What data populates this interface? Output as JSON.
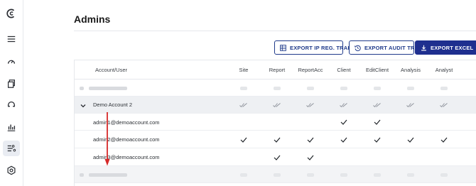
{
  "page": {
    "title": "Admins"
  },
  "sidebar": {
    "items": [
      {
        "name": "logo-icon",
        "active": false
      },
      {
        "name": "menu-icon",
        "active": false
      },
      {
        "name": "gauge-icon",
        "active": false
      },
      {
        "name": "copy-icon",
        "active": false
      },
      {
        "name": "headset-icon",
        "active": false
      },
      {
        "name": "bar-chart-icon",
        "active": false
      },
      {
        "name": "list-settings-icon",
        "active": true
      },
      {
        "name": "settings-icon",
        "active": false
      }
    ]
  },
  "toolbar": {
    "export_ip_label": "EXPORT IP REG. TRAIL",
    "export_audit_label": "EXPORT AUDIT TRAIL",
    "export_excel_label": "EXPORT EXCEL"
  },
  "table": {
    "columns": [
      "Account/User",
      "Site",
      "Report",
      "ReportAcc",
      "Client",
      "EditClient",
      "Analysis",
      "Analyst"
    ],
    "group": {
      "label": "Demo Account 2",
      "expanded": true
    },
    "users": [
      {
        "email": "admin1@demoaccount.com",
        "perms": [
          false,
          false,
          false,
          true,
          true,
          false,
          false
        ]
      },
      {
        "email": "admin2@demoaccount.com",
        "perms": [
          true,
          true,
          true,
          true,
          true,
          true,
          true
        ]
      },
      {
        "email": "admin3@demoaccount.com",
        "perms": [
          false,
          true,
          true,
          false,
          false,
          false,
          false
        ]
      }
    ]
  },
  "colors": {
    "accent": "#1f2f8f",
    "annotation_arrow": "#d62828"
  }
}
